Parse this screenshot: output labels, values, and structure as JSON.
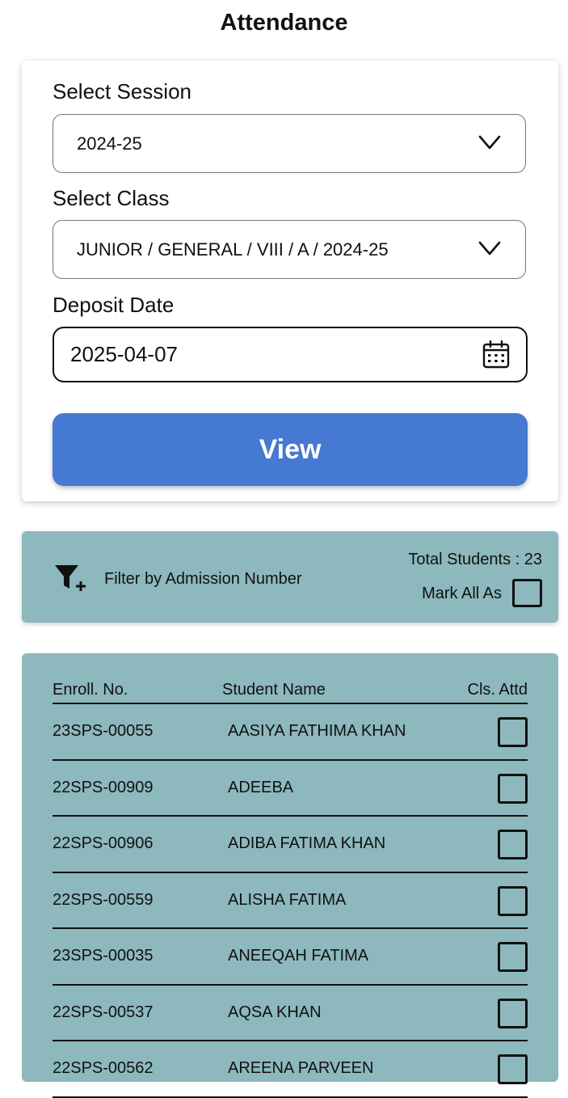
{
  "header": {
    "title": "Attendance"
  },
  "form": {
    "session_label": "Select Session",
    "session_value": "2024-25",
    "class_label": "Select Class",
    "class_value": "JUNIOR / GENERAL / VIII / A / 2024-25",
    "date_label": "Deposit Date",
    "date_value": "2025-04-07",
    "view_label": "View"
  },
  "filter": {
    "label": "Filter by Admission Number",
    "total_students": "Total Students : 23",
    "mark_all_label": "Mark All As"
  },
  "table": {
    "columns": [
      "Enroll. No.",
      "Student Name",
      "Cls. Attd"
    ],
    "rows": [
      {
        "enroll": "23SPS-00055",
        "name": "AASIYA FATHIMA KHAN"
      },
      {
        "enroll": "22SPS-00909",
        "name": "ADEEBA"
      },
      {
        "enroll": "22SPS-00906",
        "name": "ADIBA FATIMA KHAN"
      },
      {
        "enroll": "22SPS-00559",
        "name": "ALISHA FATIMA"
      },
      {
        "enroll": "23SPS-00035",
        "name": "ANEEQAH FATIMA"
      },
      {
        "enroll": "22SPS-00537",
        "name": "AQSA KHAN"
      },
      {
        "enroll": "22SPS-00562",
        "name": "AREENA PARVEEN"
      }
    ]
  },
  "colors": {
    "accent": "#4679d1",
    "panel": "#8db8bd"
  }
}
